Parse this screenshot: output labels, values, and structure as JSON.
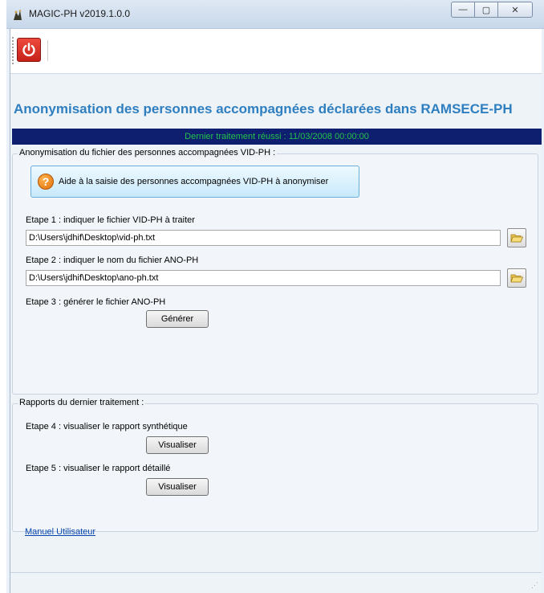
{
  "window": {
    "title": "MAGIC-PH  v2019.1.0.0",
    "controls": {
      "minimize": "—",
      "maximize": "▢",
      "close": "✕"
    }
  },
  "toolbar": {
    "power_icon": "power-icon"
  },
  "page": {
    "title": "Anonymisation des personnes accompagnées déclarées dans RAMSECE-PH",
    "last_run": "Dernier traitement réussi : 11/03/2008 00:00:00"
  },
  "anonymisation": {
    "legend": "Anonymisation du fichier des personnes accompagnées VID-PH :",
    "help_label": "Aide à la saisie des personnes accompagnées VID-PH à anonymiser",
    "step1_label": "Etape 1 : indiquer le fichier VID-PH à traiter",
    "step1_value": "D:\\Users\\jdhif\\Desktop\\vid-ph.txt",
    "step2_label": "Etape 2 : indiquer le nom du fichier ANO-PH",
    "step2_value": "D:\\Users\\jdhif\\Desktop\\ano-ph.txt",
    "step3_label": "Etape 3 : générer le fichier ANO-PH",
    "generate_label": "Générer"
  },
  "reports": {
    "legend": "Rapports du dernier traitement :",
    "step4_label": "Etape 4 : visualiser le rapport synthétique",
    "step4_button": "Visualiser",
    "step5_label": "Etape 5 : visualiser le rapport détaillé",
    "step5_button": "Visualiser"
  },
  "footer": {
    "manual_link": "Manuel Utilisateur"
  },
  "colors": {
    "title_blue": "#2f7fc0",
    "status_bg": "#0d1f6e",
    "status_text": "#24c24a",
    "power_red": "#d42a20"
  }
}
